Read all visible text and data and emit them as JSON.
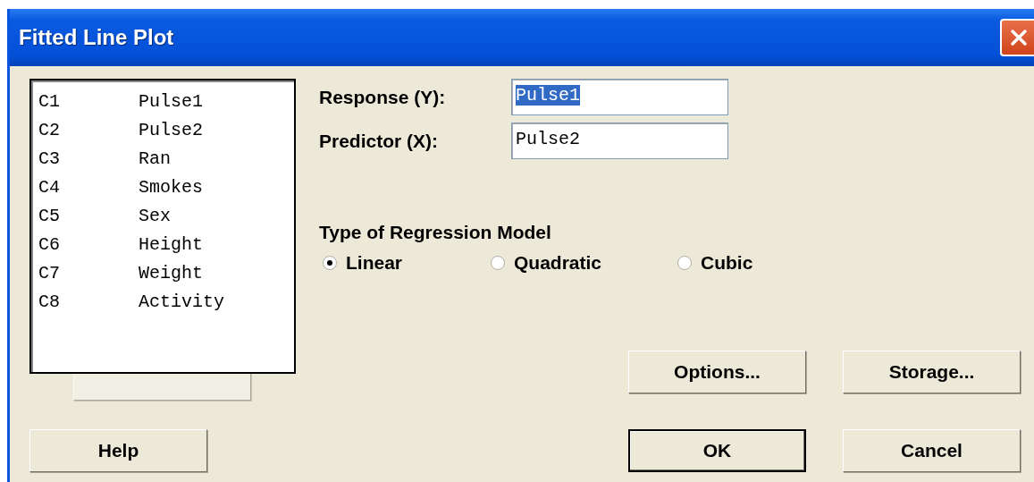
{
  "window": {
    "title": "Fitted Line Plot"
  },
  "variables": [
    {
      "column": "C1",
      "name": "Pulse1"
    },
    {
      "column": "C2",
      "name": "Pulse2"
    },
    {
      "column": "C3",
      "name": "Ran"
    },
    {
      "column": "C4",
      "name": "Smokes"
    },
    {
      "column": "C5",
      "name": "Sex"
    },
    {
      "column": "C6",
      "name": "Height"
    },
    {
      "column": "C7",
      "name": "Weight"
    },
    {
      "column": "C8",
      "name": "Activity"
    }
  ],
  "select_button": {
    "disabled": true
  },
  "fields": [
    {
      "label": "Response (Y):",
      "value": "Pulse1",
      "text_selected": true
    },
    {
      "label": "Predictor (X):",
      "value": "Pulse2",
      "text_selected": false
    }
  ],
  "regression_model": {
    "label": "Type of Regression Model",
    "options": [
      {
        "label": "Linear",
        "selected": true
      },
      {
        "label": "Quadratic",
        "selected": false
      },
      {
        "label": "Cubic",
        "selected": false
      }
    ]
  },
  "side_buttons": [
    {
      "label": "Options...",
      "default": false
    },
    {
      "label": "Storage...",
      "default": false
    }
  ],
  "help_button": {
    "label": "Help",
    "default": false
  },
  "bottom_buttons": [
    {
      "label": "OK",
      "default": true
    },
    {
      "label": "Cancel",
      "default": false
    }
  ]
}
